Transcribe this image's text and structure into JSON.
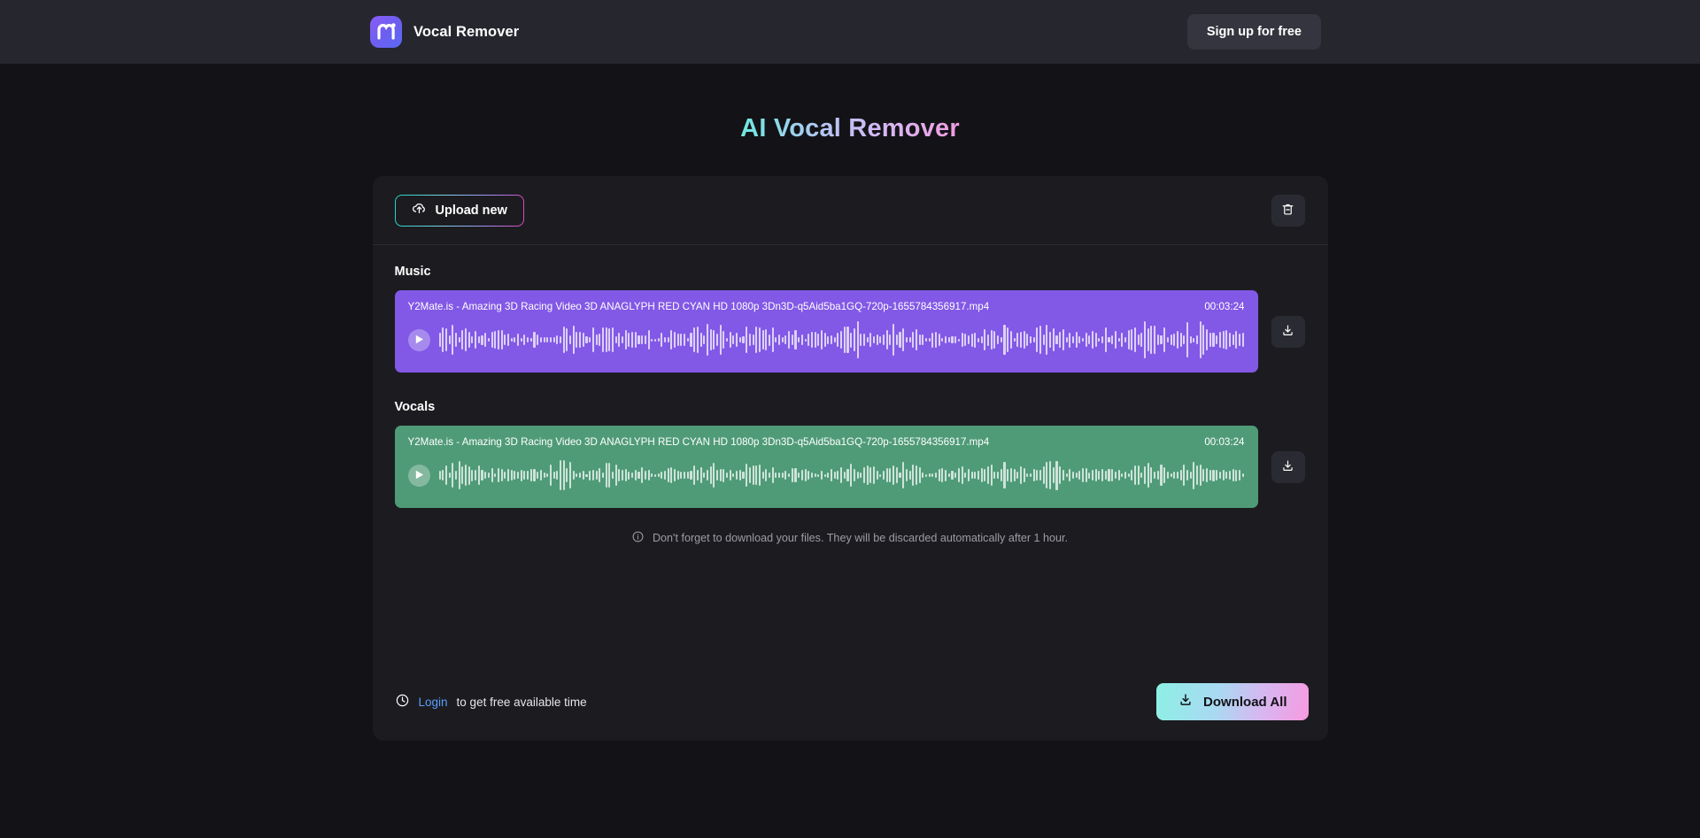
{
  "header": {
    "brand_name": "Vocal Remover",
    "logo_icon": "m-logo-icon",
    "signup_label": "Sign up for free"
  },
  "page": {
    "title": "AI Vocal Remover"
  },
  "toolbar": {
    "upload_label": "Upload new",
    "upload_icon": "cloud-upload-icon",
    "delete_icon": "trash-icon"
  },
  "tracks": [
    {
      "label": "Music",
      "filename": "Y2Mate.is - Amazing 3D Racing Video 3D ANAGLYPH RED CYAN HD 1080p 3Dn3D-q5Aid5ba1GQ-720p-1655784356917.mp4",
      "duration": "00:03:24",
      "color": "#8258e6",
      "play_icon": "play-icon",
      "download_icon": "download-icon"
    },
    {
      "label": "Vocals",
      "filename": "Y2Mate.is - Amazing 3D Racing Video 3D ANAGLYPH RED CYAN HD 1080p 3Dn3D-q5Aid5ba1GQ-720p-1655784356917.mp4",
      "duration": "00:03:24",
      "color": "#4f9b77",
      "play_icon": "play-icon",
      "download_icon": "download-icon"
    }
  ],
  "notice": {
    "icon": "info-icon",
    "text": "Don't forget to download your files. They will be discarded automatically after 1 hour."
  },
  "footer": {
    "clock_icon": "clock-icon",
    "login_label": "Login",
    "login_suffix": " to get free available time",
    "download_all_label": "Download All",
    "download_all_icon": "download-icon"
  },
  "colors": {
    "page_background": "#131317",
    "header_background": "#26262f",
    "panel_background": "#1c1c20",
    "music_track": "#8258e6",
    "vocals_track": "#4f9b77",
    "link": "#5b9df9",
    "gradient_start": "#6ee7e0",
    "gradient_end": "#f09ce0"
  }
}
